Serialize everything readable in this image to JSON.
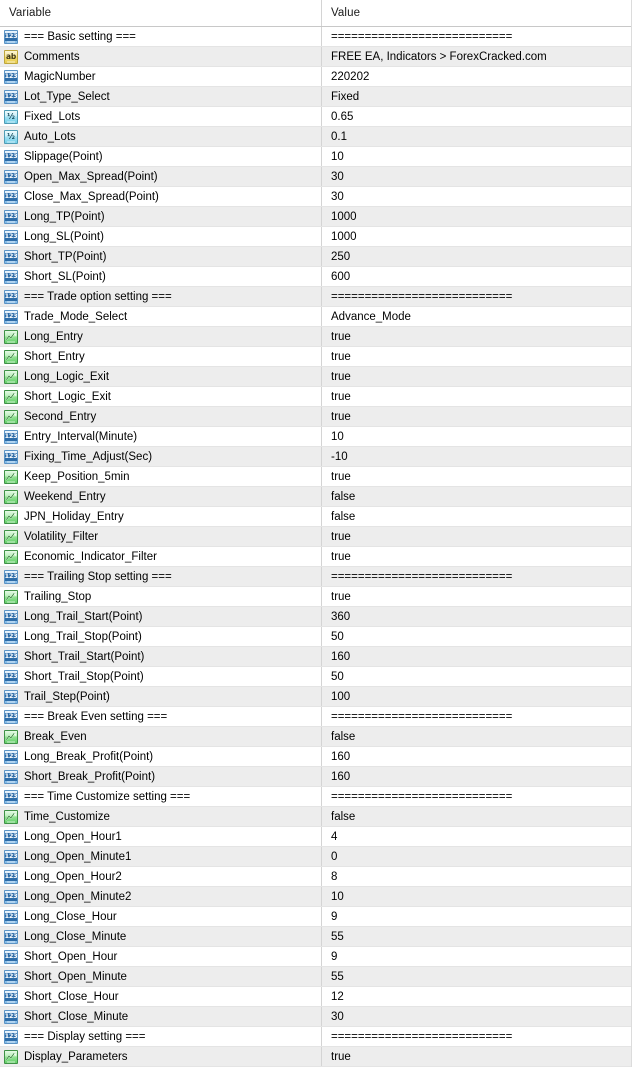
{
  "header": {
    "variable_label": "Variable",
    "value_label": "Value"
  },
  "separator_text": "===========================",
  "icons": {
    "int": "int-type-icon",
    "string": "string-type-icon",
    "double": "double-type-icon",
    "bool": "bool-type-icon"
  },
  "colors": {
    "row_alt_bg": "#ededed",
    "row_bg": "#ffffff",
    "grid_line": "#e4e4e4",
    "column_divider": "#d4d4d4",
    "header_border": "#c8c8c8",
    "text": "#000000",
    "icon_int": "#7fb8e6",
    "icon_string": "#e8cc4e",
    "icon_double": "#73cfe9",
    "icon_bool": "#63cf68"
  },
  "rows": [
    {
      "type": "int",
      "glyph": "123",
      "variable": "=== Basic setting ===",
      "value": "==========================="
    },
    {
      "type": "string",
      "glyph": "ab",
      "variable": "Comments",
      "value": "FREE EA, Indicators > ForexCracked.com"
    },
    {
      "type": "int",
      "glyph": "123",
      "variable": "MagicNumber",
      "value": "220202"
    },
    {
      "type": "int",
      "glyph": "123",
      "variable": "Lot_Type_Select",
      "value": "Fixed"
    },
    {
      "type": "double",
      "glyph": "½",
      "variable": "Fixed_Lots",
      "value": "0.65"
    },
    {
      "type": "double",
      "glyph": "½",
      "variable": "Auto_Lots",
      "value": "0.1"
    },
    {
      "type": "int",
      "glyph": "123",
      "variable": "Slippage(Point)",
      "value": "10"
    },
    {
      "type": "int",
      "glyph": "123",
      "variable": "Open_Max_Spread(Point)",
      "value": "30"
    },
    {
      "type": "int",
      "glyph": "123",
      "variable": "Close_Max_Spread(Point)",
      "value": "30"
    },
    {
      "type": "int",
      "glyph": "123",
      "variable": "Long_TP(Point)",
      "value": "1000"
    },
    {
      "type": "int",
      "glyph": "123",
      "variable": "Long_SL(Point)",
      "value": "1000"
    },
    {
      "type": "int",
      "glyph": "123",
      "variable": "Short_TP(Point)",
      "value": "250"
    },
    {
      "type": "int",
      "glyph": "123",
      "variable": "Short_SL(Point)",
      "value": "600"
    },
    {
      "type": "int",
      "glyph": "123",
      "variable": "=== Trade option setting ===",
      "value": "==========================="
    },
    {
      "type": "int",
      "glyph": "123",
      "variable": "Trade_Mode_Select",
      "value": "Advance_Mode"
    },
    {
      "type": "bool",
      "glyph": "",
      "variable": "Long_Entry",
      "value": "true"
    },
    {
      "type": "bool",
      "glyph": "",
      "variable": "Short_Entry",
      "value": "true"
    },
    {
      "type": "bool",
      "glyph": "",
      "variable": "Long_Logic_Exit",
      "value": "true"
    },
    {
      "type": "bool",
      "glyph": "",
      "variable": "Short_Logic_Exit",
      "value": "true"
    },
    {
      "type": "bool",
      "glyph": "",
      "variable": "Second_Entry",
      "value": "true"
    },
    {
      "type": "int",
      "glyph": "123",
      "variable": "Entry_Interval(Minute)",
      "value": "10"
    },
    {
      "type": "int",
      "glyph": "123",
      "variable": "Fixing_Time_Adjust(Sec)",
      "value": "-10"
    },
    {
      "type": "bool",
      "glyph": "",
      "variable": "Keep_Position_5min",
      "value": "true"
    },
    {
      "type": "bool",
      "glyph": "",
      "variable": "Weekend_Entry",
      "value": "false"
    },
    {
      "type": "bool",
      "glyph": "",
      "variable": "JPN_Holiday_Entry",
      "value": "false"
    },
    {
      "type": "bool",
      "glyph": "",
      "variable": "Volatility_Filter",
      "value": "true"
    },
    {
      "type": "bool",
      "glyph": "",
      "variable": "Economic_Indicator_Filter",
      "value": "true"
    },
    {
      "type": "int",
      "glyph": "123",
      "variable": "=== Trailing Stop setting ===",
      "value": "==========================="
    },
    {
      "type": "bool",
      "glyph": "",
      "variable": "Trailing_Stop",
      "value": "true"
    },
    {
      "type": "int",
      "glyph": "123",
      "variable": "Long_Trail_Start(Point)",
      "value": "360"
    },
    {
      "type": "int",
      "glyph": "123",
      "variable": "Long_Trail_Stop(Point)",
      "value": "50"
    },
    {
      "type": "int",
      "glyph": "123",
      "variable": "Short_Trail_Start(Point)",
      "value": "160"
    },
    {
      "type": "int",
      "glyph": "123",
      "variable": "Short_Trail_Stop(Point)",
      "value": "50"
    },
    {
      "type": "int",
      "glyph": "123",
      "variable": "Trail_Step(Point)",
      "value": "100"
    },
    {
      "type": "int",
      "glyph": "123",
      "variable": "=== Break Even setting ===",
      "value": "==========================="
    },
    {
      "type": "bool",
      "glyph": "",
      "variable": "Break_Even",
      "value": "false"
    },
    {
      "type": "int",
      "glyph": "123",
      "variable": "Long_Break_Profit(Point)",
      "value": "160"
    },
    {
      "type": "int",
      "glyph": "123",
      "variable": "Short_Break_Profit(Point)",
      "value": "160"
    },
    {
      "type": "int",
      "glyph": "123",
      "variable": "=== Time Customize setting ===",
      "value": "==========================="
    },
    {
      "type": "bool",
      "glyph": "",
      "variable": "Time_Customize",
      "value": "false"
    },
    {
      "type": "int",
      "glyph": "123",
      "variable": "Long_Open_Hour1",
      "value": "4"
    },
    {
      "type": "int",
      "glyph": "123",
      "variable": "Long_Open_Minute1",
      "value": "0"
    },
    {
      "type": "int",
      "glyph": "123",
      "variable": "Long_Open_Hour2",
      "value": "8"
    },
    {
      "type": "int",
      "glyph": "123",
      "variable": "Long_Open_Minute2",
      "value": "10"
    },
    {
      "type": "int",
      "glyph": "123",
      "variable": "Long_Close_Hour",
      "value": "9"
    },
    {
      "type": "int",
      "glyph": "123",
      "variable": "Long_Close_Minute",
      "value": "55"
    },
    {
      "type": "int",
      "glyph": "123",
      "variable": "Short_Open_Hour",
      "value": "9"
    },
    {
      "type": "int",
      "glyph": "123",
      "variable": "Short_Open_Minute",
      "value": "55"
    },
    {
      "type": "int",
      "glyph": "123",
      "variable": "Short_Close_Hour",
      "value": "12"
    },
    {
      "type": "int",
      "glyph": "123",
      "variable": "Short_Close_Minute",
      "value": "30"
    },
    {
      "type": "int",
      "glyph": "123",
      "variable": "=== Display setting ===",
      "value": "==========================="
    },
    {
      "type": "bool",
      "glyph": "",
      "variable": "Display_Parameters",
      "value": "true"
    }
  ]
}
